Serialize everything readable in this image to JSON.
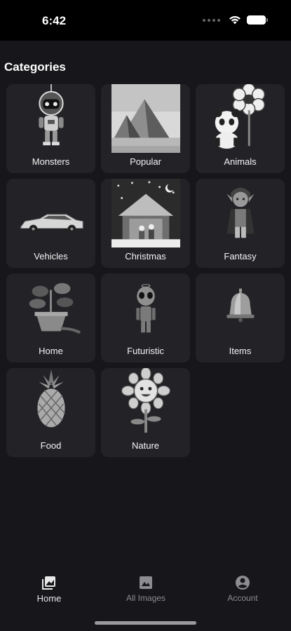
{
  "status_bar": {
    "time": "6:42"
  },
  "section_title": "Categories",
  "categories": [
    {
      "label": "Monsters",
      "icon": "robot-monster-icon"
    },
    {
      "label": "Popular",
      "icon": "pyramids-icon"
    },
    {
      "label": "Animals",
      "icon": "panda-flower-icon"
    },
    {
      "label": "Vehicles",
      "icon": "car-icon"
    },
    {
      "label": "Christmas",
      "icon": "nativity-icon"
    },
    {
      "label": "Fantasy",
      "icon": "elf-icon"
    },
    {
      "label": "Home",
      "icon": "potted-plant-icon"
    },
    {
      "label": "Futuristic",
      "icon": "alien-icon"
    },
    {
      "label": "Items",
      "icon": "bell-icon"
    },
    {
      "label": "Food",
      "icon": "pineapple-icon"
    },
    {
      "label": "Nature",
      "icon": "sunflower-icon"
    }
  ],
  "bottom_nav": {
    "home": "Home",
    "all_images": "All Images",
    "account": "Account"
  }
}
